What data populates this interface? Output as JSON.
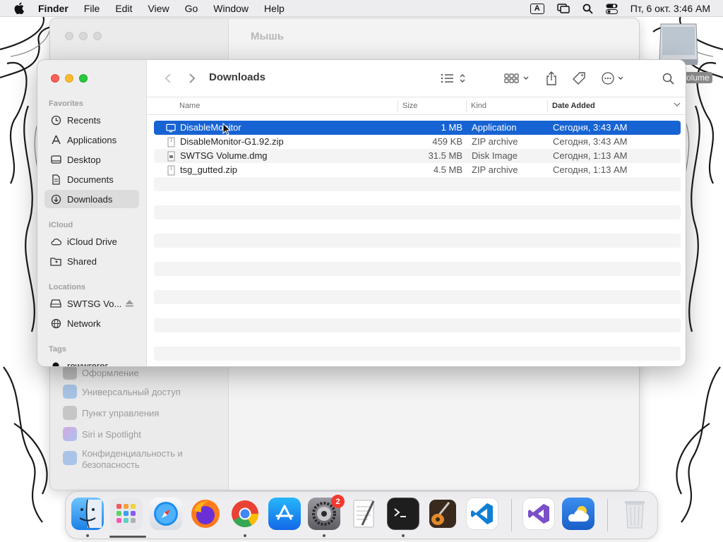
{
  "menubar": {
    "app_name": "Finder",
    "items": [
      "File",
      "Edit",
      "View",
      "Go",
      "Window",
      "Help"
    ],
    "input_indicator": "A",
    "datetime": "Пт, 6 окт.  3:46 AM"
  },
  "settings_window": {
    "title": "Мышь",
    "items": [
      "Оформление",
      "Универсальный доступ",
      "Пункт управления",
      "Siri и Spotlight",
      "Конфиденциальность и",
      "безопасность"
    ]
  },
  "desktop": {
    "volume_label": "olume"
  },
  "finder": {
    "title": "Downloads",
    "sections": {
      "favorites": "Favorites",
      "icloud": "iCloud",
      "locations": "Locations",
      "tags": "Tags"
    },
    "favorites": [
      "Recents",
      "Applications",
      "Desktop",
      "Documents",
      "Downloads"
    ],
    "icloud": [
      "iCloud Drive",
      "Shared"
    ],
    "locations": [
      "SWTSG Vo...",
      "Network"
    ],
    "tags": [
      "rewwrerer"
    ],
    "columns": {
      "name": "Name",
      "size": "Size",
      "kind": "Kind",
      "date": "Date Added"
    },
    "files": [
      {
        "name": "DisableMonitor",
        "size": "1 MB",
        "kind": "Application",
        "date": "Сегодня, 3:43 AM"
      },
      {
        "name": "DisableMonitor-G1.92.zip",
        "size": "459 KB",
        "kind": "ZIP archive",
        "date": "Сегодня, 3:43 AM"
      },
      {
        "name": "SWTSG Volume.dmg",
        "size": "31.5 MB",
        "kind": "Disk Image",
        "date": "Сегодня, 1:13 AM"
      },
      {
        "name": "tsg_gutted.zip",
        "size": "4.5 MB",
        "kind": "ZIP archive",
        "date": "Сегодня, 1:13 AM"
      }
    ]
  },
  "dock": {
    "settings_badge": "2"
  },
  "colors": {
    "selection": "#1763d3",
    "close": "#ff5f57",
    "minimize": "#febc2e",
    "maximize": "#28c840"
  }
}
